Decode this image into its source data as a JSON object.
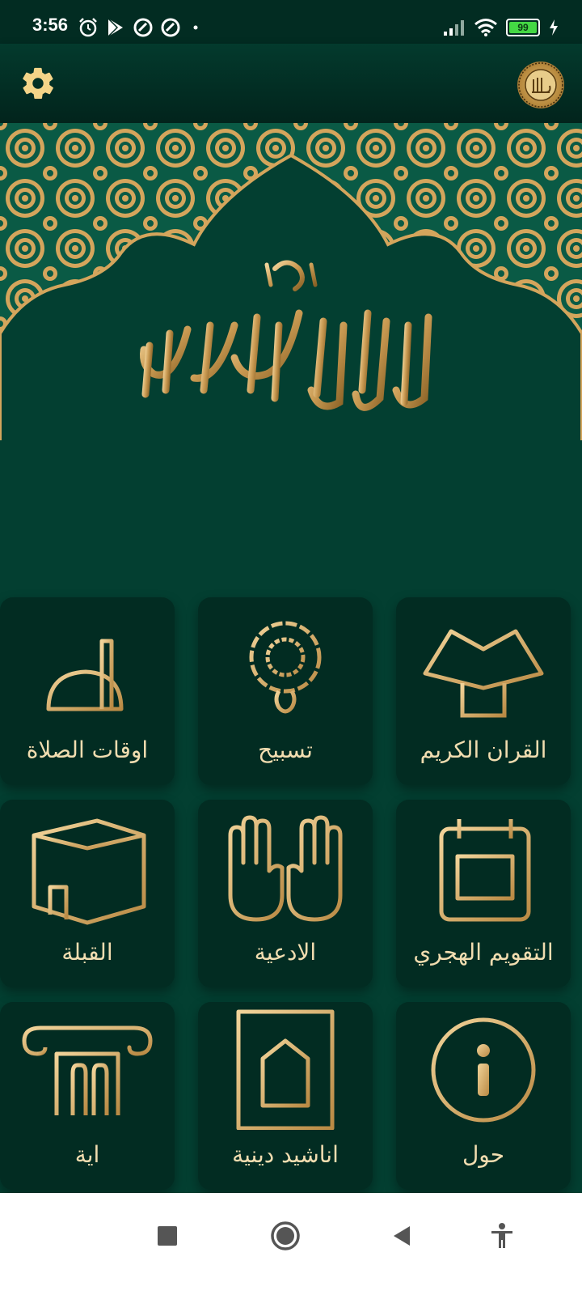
{
  "status_bar": {
    "time": "3:56",
    "battery_level": "99",
    "battery_fraction": 0.99
  },
  "app_bar": {
    "settings_icon": "gear-icon",
    "logo_icon": "allah-calligraphy-logo"
  },
  "banner": {
    "calligraphy_icon": "shahada-calligraphy",
    "colors": {
      "gold": "#c99a52",
      "green": "#033f31"
    }
  },
  "menu": {
    "items": [
      {
        "label": "القران الكريم",
        "icon": "quran-stand-icon"
      },
      {
        "label": "تسبيح",
        "icon": "prayer-beads-icon"
      },
      {
        "label": "اوقات الصلاة",
        "icon": "mosque-dome-icon"
      },
      {
        "label": "التقويم الهجري",
        "icon": "calendar-icon"
      },
      {
        "label": "الادعية",
        "icon": "praying-hands-icon"
      },
      {
        "label": "القبلة",
        "icon": "kaaba-icon"
      },
      {
        "label": "حول",
        "icon": "info-icon"
      },
      {
        "label": "اناشيد دينية",
        "icon": "prayer-rug-icon"
      },
      {
        "label": "اية",
        "icon": "column-icon"
      }
    ]
  },
  "nav_bar": {
    "recents_icon": "square-icon",
    "home_icon": "circle-icon",
    "back_icon": "triangle-back-icon",
    "accessibility_icon": "accessibility-icon"
  }
}
